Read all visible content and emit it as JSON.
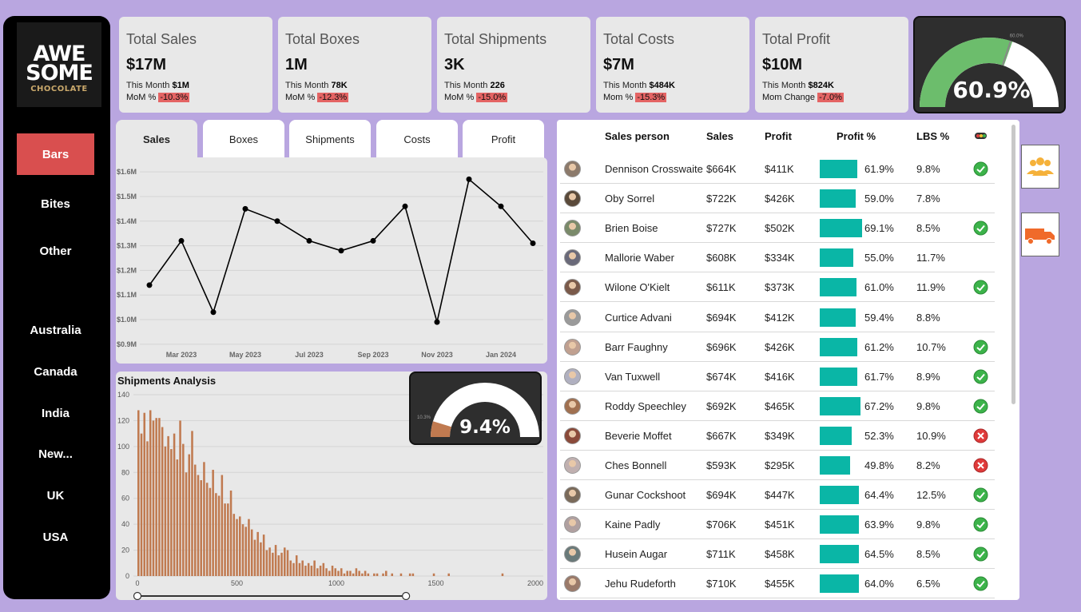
{
  "logo": {
    "line1": "AWE",
    "line2": "SOME",
    "line3": "CHOCOLATE"
  },
  "nav": {
    "categories": [
      "Bars",
      "Bites",
      "Other"
    ],
    "countries": [
      "Australia",
      "Canada",
      "India",
      "New...",
      "UK",
      "USA"
    ],
    "active": "Bars"
  },
  "kpis": [
    {
      "title": "Total Sales",
      "value": "$17M",
      "month_label": "This Month",
      "month_value": "$1M",
      "change_label": "MoM %",
      "change_value": "-10.3%"
    },
    {
      "title": "Total Boxes",
      "value": "1M",
      "month_label": "This Month",
      "month_value": "78K",
      "change_label": "MoM %",
      "change_value": "-12.3%"
    },
    {
      "title": "Total Shipments",
      "value": "3K",
      "month_label": "This Month",
      "month_value": "226",
      "change_label": "MoM %",
      "change_value": "-15.0%"
    },
    {
      "title": "Total Costs",
      "value": "$7M",
      "month_label": "This Month",
      "month_value": "$484K",
      "change_label": "Mom %",
      "change_value": "-15.3%"
    },
    {
      "title": "Total Profit",
      "value": "$10M",
      "month_label": "This Month",
      "month_value": "$824K",
      "change_label": "Mom Change",
      "change_value": "-7.0%"
    }
  ],
  "profit_gauge": {
    "value_label": "60.9%",
    "value": 60.9,
    "target_label": "60.0%",
    "fill_color": "#6cbd6c",
    "track_color": "#ffffff"
  },
  "tabs": [
    "Sales",
    "Boxes",
    "Shipments",
    "Costs",
    "Profit"
  ],
  "active_tab": "Sales",
  "colors": {
    "accent_red": "#d94f4f",
    "bar_teal": "#0ab6a6",
    "hist_brown": "#c07a50",
    "background": "#b9a6e0"
  },
  "chart_data": [
    {
      "type": "line",
      "title": "",
      "xlabel": "",
      "ylabel": "",
      "x": [
        "Feb 2023",
        "Mar 2023",
        "Apr 2023",
        "May 2023",
        "Jun 2023",
        "Jul 2023",
        "Aug 2023",
        "Sep 2023",
        "Oct 2023",
        "Nov 2023",
        "Dec 2023",
        "Jan 2024",
        "Feb 2024"
      ],
      "values": [
        1.14,
        1.32,
        1.03,
        1.45,
        1.4,
        1.32,
        1.28,
        1.32,
        1.46,
        0.99,
        1.57,
        1.46,
        1.31
      ],
      "x_tick_labels": [
        "Mar 2023",
        "May 2023",
        "Jul 2023",
        "Sep 2023",
        "Nov 2023",
        "Jan 2024"
      ],
      "y_tick_labels": [
        "$1.6M",
        "$1.5M",
        "$1.4M",
        "$1.3M",
        "$1.2M",
        "$1.1M",
        "$1.0M",
        "$0.9M"
      ],
      "y_ticks": [
        1.6,
        1.5,
        1.4,
        1.3,
        1.2,
        1.1,
        1.0,
        0.9
      ],
      "ylim": [
        0.88,
        1.62
      ],
      "grid": true
    },
    {
      "type": "bar",
      "title": "Shipments Analysis",
      "xlabel": "",
      "ylabel": "",
      "x_tick_labels": [
        "0",
        "500",
        "1000",
        "1500",
        "2000"
      ],
      "x_ticks": [
        0,
        500,
        1000,
        1500,
        2000
      ],
      "xlim": [
        0,
        2000
      ],
      "y_tick_labels": [
        "140",
        "120",
        "100",
        "80",
        "60",
        "40",
        "20",
        "0"
      ],
      "y_ticks": [
        140,
        120,
        100,
        80,
        60,
        40,
        20,
        0
      ],
      "ylim": [
        0,
        140
      ],
      "bin_width": 15,
      "values": [
        128,
        110,
        126,
        104,
        128,
        120,
        122,
        122,
        115,
        100,
        108,
        98,
        110,
        90,
        120,
        102,
        80,
        94,
        112,
        86,
        78,
        74,
        88,
        72,
        68,
        82,
        64,
        62,
        78,
        56,
        56,
        66,
        48,
        44,
        46,
        40,
        38,
        44,
        36,
        28,
        34,
        26,
        32,
        20,
        22,
        18,
        24,
        16,
        18,
        22,
        20,
        12,
        10,
        16,
        10,
        12,
        8,
        10,
        8,
        12,
        6,
        8,
        10,
        6,
        4,
        8,
        6,
        4,
        6,
        2,
        4,
        4,
        2,
        6,
        4,
        2,
        4,
        2,
        0,
        2,
        2,
        0,
        2,
        4,
        0,
        2,
        0,
        0,
        2,
        0,
        0,
        2,
        2,
        0,
        0,
        0,
        0,
        0,
        0,
        2,
        0,
        0,
        0,
        0,
        2,
        0,
        0,
        0,
        0,
        0,
        0,
        0,
        0,
        0,
        0,
        0,
        0,
        0,
        0,
        0,
        0,
        0,
        2
      ],
      "range_slider": [
        0,
        1350
      ]
    }
  ],
  "shipments_title": "Shipments Analysis",
  "shipment_gauge": {
    "value_label": "9.4%",
    "value": 9.4,
    "target_label": "10.3%",
    "fill_color": "#c07a50",
    "track_color": "#ffffff"
  },
  "table": {
    "headers": {
      "person": "Sales person",
      "sales": "Sales",
      "profit": "Profit",
      "profit_pct": "Profit %",
      "lbs": "LBS %"
    },
    "rows": [
      {
        "name": "Dennison Crosswaite",
        "sales": "$664K",
        "profit": "$411K",
        "pct": "61.9%",
        "pct_value": 61.9,
        "lbs": "9.8%",
        "status": "ok"
      },
      {
        "name": "Oby Sorrel",
        "sales": "$722K",
        "profit": "$426K",
        "pct": "59.0%",
        "pct_value": 59.0,
        "lbs": "7.8%",
        "status": ""
      },
      {
        "name": "Brien Boise",
        "sales": "$727K",
        "profit": "$502K",
        "pct": "69.1%",
        "pct_value": 69.1,
        "lbs": "8.5%",
        "status": "ok"
      },
      {
        "name": "Mallorie Waber",
        "sales": "$608K",
        "profit": "$334K",
        "pct": "55.0%",
        "pct_value": 55.0,
        "lbs": "11.7%",
        "status": ""
      },
      {
        "name": "Wilone O'Kielt",
        "sales": "$611K",
        "profit": "$373K",
        "pct": "61.0%",
        "pct_value": 61.0,
        "lbs": "11.9%",
        "status": "ok"
      },
      {
        "name": "Curtice Advani",
        "sales": "$694K",
        "profit": "$412K",
        "pct": "59.4%",
        "pct_value": 59.4,
        "lbs": "8.8%",
        "status": ""
      },
      {
        "name": "Barr Faughny",
        "sales": "$696K",
        "profit": "$426K",
        "pct": "61.2%",
        "pct_value": 61.2,
        "lbs": "10.7%",
        "status": "ok"
      },
      {
        "name": "Van Tuxwell",
        "sales": "$674K",
        "profit": "$416K",
        "pct": "61.7%",
        "pct_value": 61.7,
        "lbs": "8.9%",
        "status": "ok"
      },
      {
        "name": "Roddy Speechley",
        "sales": "$692K",
        "profit": "$465K",
        "pct": "67.2%",
        "pct_value": 67.2,
        "lbs": "9.8%",
        "status": "ok"
      },
      {
        "name": "Beverie Moffet",
        "sales": "$667K",
        "profit": "$349K",
        "pct": "52.3%",
        "pct_value": 52.3,
        "lbs": "10.9%",
        "status": "bad"
      },
      {
        "name": "Ches Bonnell",
        "sales": "$593K",
        "profit": "$295K",
        "pct": "49.8%",
        "pct_value": 49.8,
        "lbs": "8.2%",
        "status": "bad"
      },
      {
        "name": "Gunar Cockshoot",
        "sales": "$694K",
        "profit": "$447K",
        "pct": "64.4%",
        "pct_value": 64.4,
        "lbs": "12.5%",
        "status": "ok"
      },
      {
        "name": "Kaine Padly",
        "sales": "$706K",
        "profit": "$451K",
        "pct": "63.9%",
        "pct_value": 63.9,
        "lbs": "9.8%",
        "status": "ok"
      },
      {
        "name": "Husein Augar",
        "sales": "$711K",
        "profit": "$458K",
        "pct": "64.5%",
        "pct_value": 64.5,
        "lbs": "8.5%",
        "status": "ok"
      },
      {
        "name": "Jehu Rudeforth",
        "sales": "$710K",
        "profit": "$455K",
        "pct": "64.0%",
        "pct_value": 64.0,
        "lbs": "6.5%",
        "status": "ok"
      }
    ]
  },
  "side_buttons": [
    "people-icon",
    "truck-icon"
  ]
}
